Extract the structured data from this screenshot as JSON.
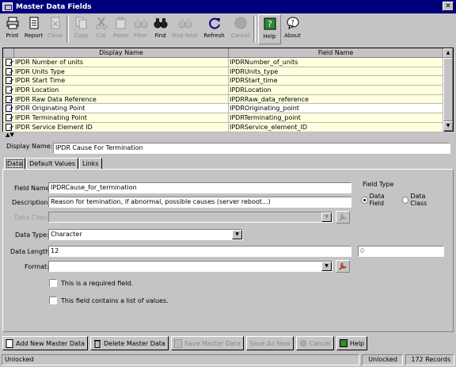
{
  "window": {
    "title": "Master Data Fields",
    "close_glyph": "✕"
  },
  "toolbar": {
    "items": [
      {
        "label": "Print",
        "icon": "printer-icon",
        "enabled": true
      },
      {
        "label": "Report",
        "icon": "report-icon",
        "enabled": true
      },
      {
        "label": "Close",
        "icon": "close-doc-icon",
        "enabled": false
      },
      {
        "label": "Copy",
        "icon": "copy-icon",
        "enabled": false
      },
      {
        "label": "Cut",
        "icon": "scissors-icon",
        "enabled": false
      },
      {
        "label": "Paste",
        "icon": "paste-icon",
        "enabled": false
      },
      {
        "label": "Filter",
        "icon": "binoculars-icon",
        "enabled": false
      },
      {
        "label": "Find",
        "icon": "binoculars-icon",
        "enabled": true
      },
      {
        "label": "Find Next",
        "icon": "binoculars-next-icon",
        "enabled": false
      },
      {
        "label": "Refresh",
        "icon": "refresh-icon",
        "enabled": true
      },
      {
        "label": "Cancel",
        "icon": "stop-icon",
        "enabled": false
      },
      {
        "label": "Help",
        "icon": "help-icon",
        "enabled": true
      },
      {
        "label": "About",
        "icon": "about-icon",
        "enabled": true
      }
    ]
  },
  "grid": {
    "columns": [
      "Display Name",
      "Field Name"
    ],
    "rows": [
      {
        "display": "IPDR Number of units",
        "field": "IPDRNumber_of_units"
      },
      {
        "display": "IPDR Units Type",
        "field": "IPDRUnits_type"
      },
      {
        "display": "IPDR Start Time",
        "field": "IPDRStart_time"
      },
      {
        "display": "IPDR Location",
        "field": "IPDRLocation"
      },
      {
        "display": "IPDR Raw Data Reference",
        "field": "IPDRRaw_data_reference"
      },
      {
        "display": "IPDR Originating Point",
        "field": "IPDROriginating_point"
      },
      {
        "display": "IPDR Terminating Point",
        "field": "IPDRTerminating_point"
      },
      {
        "display": "IPDR Service Element ID",
        "field": "IPDRService_element_ID"
      }
    ]
  },
  "form": {
    "display_name_label": "Display Name:",
    "display_name_value": "IPDR Cause For Termination",
    "tabs": [
      "Data",
      "Default Values",
      "Links"
    ],
    "field_name_label": "Field Name:",
    "field_name_value": "IPDRCause_for_termination",
    "description_label": "Description:",
    "description_value": "Reason for temination, if abnormal, possible causes (server reboot...)",
    "data_class_label": "Data Class:",
    "data_class_value": "",
    "field_type_label": "Field Type",
    "field_type_options": [
      "Data Field",
      "Data Class"
    ],
    "field_type_selected": "Data Field",
    "data_type_label": "Data Type:",
    "data_type_value": "Character",
    "data_length_label": "Data Length:",
    "data_length_value": "12",
    "data_length_secondary": "0",
    "format_label": "Format:",
    "format_value": "",
    "required_label": "This is a required field.",
    "list_label": "This field contains a list of values."
  },
  "bottom_buttons": [
    {
      "label": "Add New Master Data",
      "icon": "new-doc-icon",
      "enabled": true
    },
    {
      "label": "Delete Master Data",
      "icon": "trash-icon",
      "enabled": true
    },
    {
      "label": "Save Master Data",
      "icon": "save-icon",
      "enabled": false
    },
    {
      "label": "Save As New",
      "icon": "",
      "enabled": false
    },
    {
      "label": "Cancel",
      "icon": "stop-icon",
      "enabled": false
    },
    {
      "label": "Help",
      "icon": "help-icon",
      "enabled": true
    }
  ],
  "status": {
    "left": "Unlocked",
    "middle": "Unlocked",
    "records": "172 Records"
  }
}
